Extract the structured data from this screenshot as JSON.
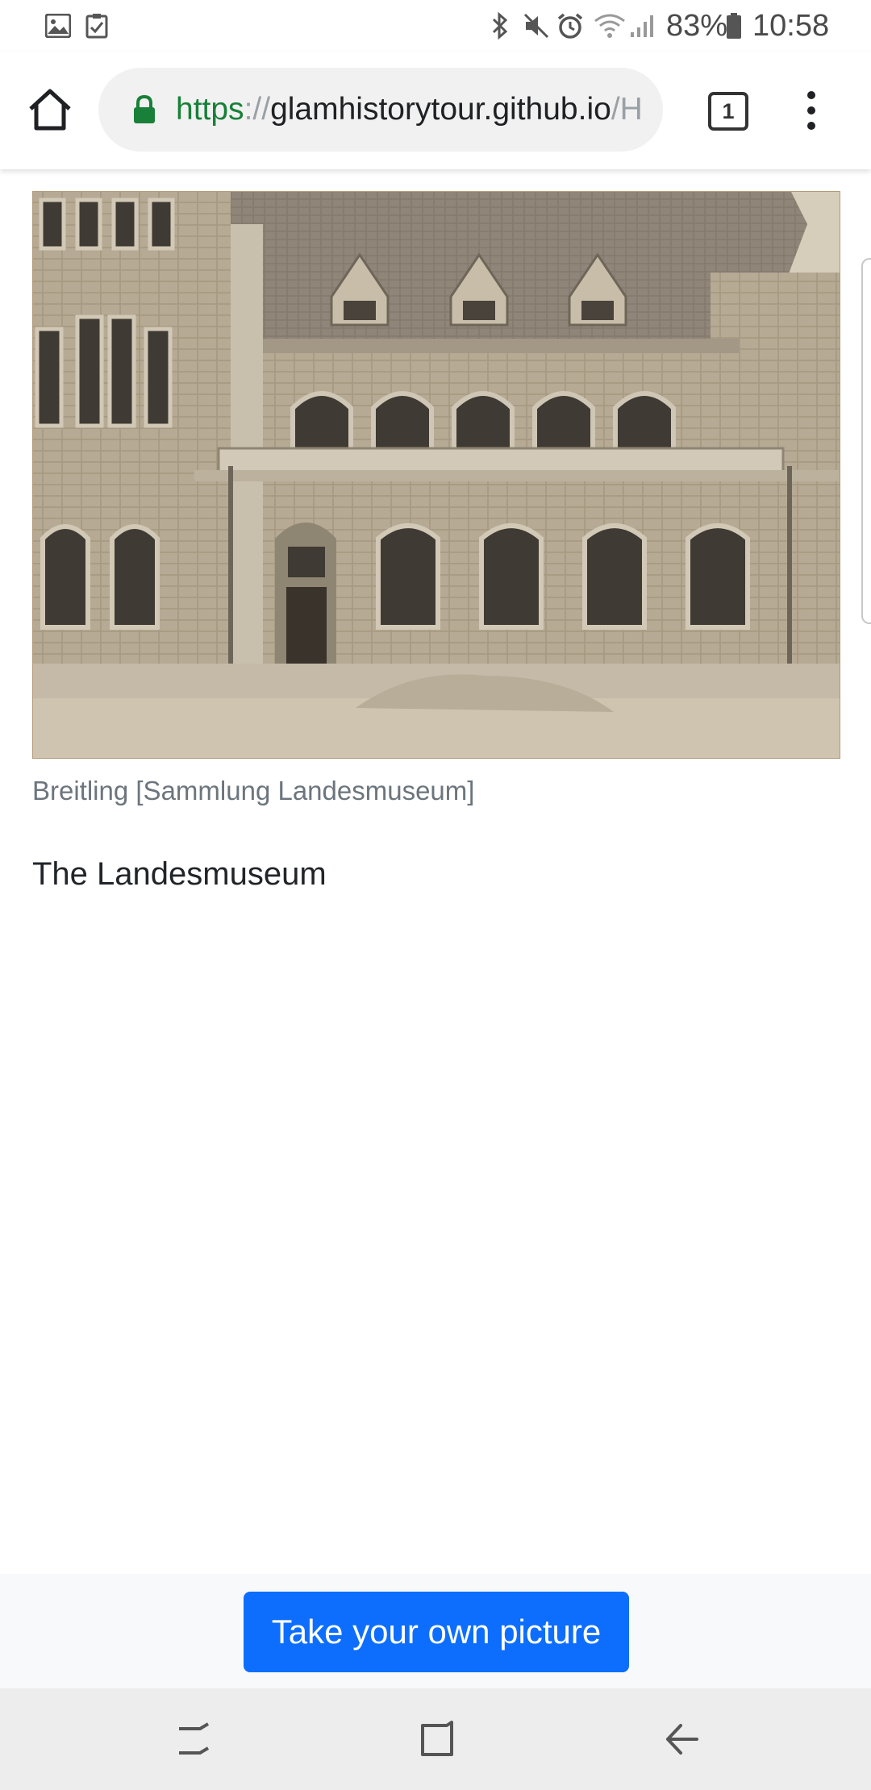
{
  "status_bar": {
    "battery": "83%",
    "time": "10:58",
    "icons": [
      "gallery-icon",
      "task-icon",
      "bluetooth-icon",
      "mute-icon",
      "alarm-icon",
      "wifi-icon",
      "signal-icon",
      "battery-icon"
    ]
  },
  "browser": {
    "url_scheme": "https",
    "url_separator": "://",
    "url_host": "glamhistorytour.github.io",
    "url_path": "/H",
    "tab_count": "1"
  },
  "page": {
    "caption": "Breitling [Sammlung Landesmuseum]",
    "heading": "The Landesmuseum",
    "take_picture_label": "Take your own picture"
  },
  "colors": {
    "primary": "#0d6efd",
    "secure": "#188038",
    "caption": "#6c757d"
  }
}
